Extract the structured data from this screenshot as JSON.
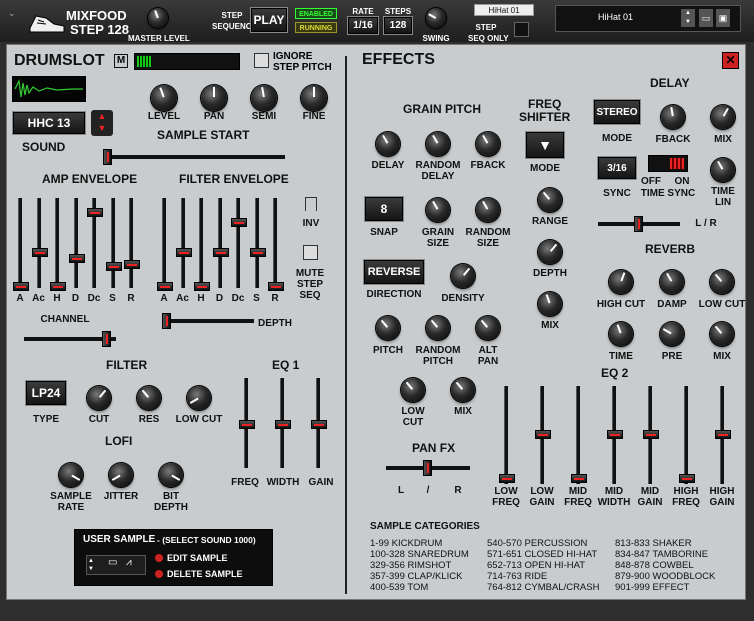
{
  "topbar": {
    "logo_line1": "MIXFOOD",
    "logo_line2": "STEP 128",
    "master_level": "MASTER LEVEL",
    "step_sequencer": "STEP\nSEQUENCER",
    "play": "PLAY",
    "enabled": "ENABLED",
    "running": "RUNNING",
    "rate_label": "RATE",
    "rate_value": "1/16",
    "steps_label": "STEPS",
    "steps_value": "128",
    "swing": "SWING",
    "preset_tag": "HiHat 01",
    "step_seq_only": "STEP\nSEQ ONLY",
    "preset_name": "HiHat 01"
  },
  "drumslot": {
    "title": "DRUMSLOT",
    "m_button": "M",
    "ignore_step_pitch": "IGNORE\nSTEP PITCH",
    "level": "LEVEL",
    "pan": "PAN",
    "semi": "SEMI",
    "fine": "FINE",
    "sound_value": "HHC 13",
    "sound_label": "SOUND",
    "sample_start": "SAMPLE START",
    "amp_envelope": "AMP ENVELOPE",
    "filter_envelope": "FILTER ENVELOPE",
    "env_labels": [
      "A",
      "Ac",
      "H",
      "D",
      "Dc",
      "S",
      "R"
    ],
    "inv": "INV",
    "mute_step_seq": "MUTE\nSTEP\nSEQ",
    "channel": "CHANNEL",
    "depth": "DEPTH",
    "filter": "FILTER",
    "filter_type": "LP24",
    "type_label": "TYPE",
    "cut": "CUT",
    "res": "RES",
    "low_cut": "LOW CUT",
    "lofi": "LOFI",
    "sample_rate": "SAMPLE\nRATE",
    "jitter": "JITTER",
    "bit_depth": "BIT\nDEPTH",
    "eq1": "EQ 1",
    "freq": "FREQ",
    "width": "WIDTH",
    "gain": "GAIN"
  },
  "user_sample": {
    "title": "USER SAMPLE",
    "hint": "-  (SELECT SOUND 1000)",
    "edit": "EDIT SAMPLE",
    "delete": "DELETE SAMPLE"
  },
  "effects": {
    "title": "EFFECTS",
    "grain_pitch": "GRAIN PITCH",
    "delay": "DELAY",
    "random_delay": "RANDOM\nDELAY",
    "fback": "FBACK",
    "snap_value": "8",
    "snap": "SNAP",
    "grain_size": "GRAIN\nSIZE",
    "random_size": "RANDOM\nSIZE",
    "reverse": "REVERSE",
    "direction": "DIRECTION",
    "density": "DENSITY",
    "pitch": "PITCH",
    "random_pitch": "RANDOM\nPITCH",
    "alt_pan": "ALT\nPAN",
    "low_cut": "LOW\nCUT",
    "mix": "MIX",
    "pan_fx": "PAN FX",
    "pan_l": "L",
    "pan_slash": "/",
    "pan_r": "R",
    "freq_shifter": "FREQ\nSHIFTER",
    "mode": "MODE",
    "range": "RANGE",
    "depth": "DEPTH",
    "delay_title": "DELAY",
    "stereo": "STEREO",
    "delay_mode": "MODE",
    "delay_fback": "FBACK",
    "delay_mix": "MIX",
    "sync_value": "3/16",
    "sync": "SYNC",
    "off": "OFF",
    "on": "ON",
    "time_sync": "TIME SYNC",
    "time_lin": "TIME\nLIN",
    "lr": "L / R",
    "reverb": "REVERB",
    "high_cut": "HIGH CUT",
    "damp": "DAMP",
    "rv_low_cut": "LOW CUT",
    "time": "TIME",
    "pre": "PRE",
    "rv_mix": "MIX",
    "eq2": "EQ 2",
    "eq2_labels": [
      "LOW\nFREQ",
      "LOW\nGAIN",
      "MID\nFREQ",
      "MID\nWIDTH",
      "MID\nGAIN",
      "HIGH\nFREQ",
      "HIGH\nGAIN"
    ]
  },
  "categories": {
    "title": "SAMPLE CATEGORIES",
    "col1": "1-99 KICKDRUM\n100-328 SNAREDRUM\n329-356 RIMSHOT\n357-399 CLAP/KLICK\n400-539 TOM",
    "col2": "540-570 PERCUSSION\n571-651 CLOSED HI-HAT\n652-713 OPEN HI-HAT\n714-763 RIDE\n764-812 CYMBAL/CRASH",
    "col3": "813-833 SHAKER\n834-847 TAMBORINE\n848-878 COWBEL\n879-900 WOODBLOCK\n901-999 EFFECT"
  },
  "colors": {
    "accent_green": "#00cc33",
    "panel_bg": "#c8cbcd",
    "close_red": "#cc2222"
  }
}
